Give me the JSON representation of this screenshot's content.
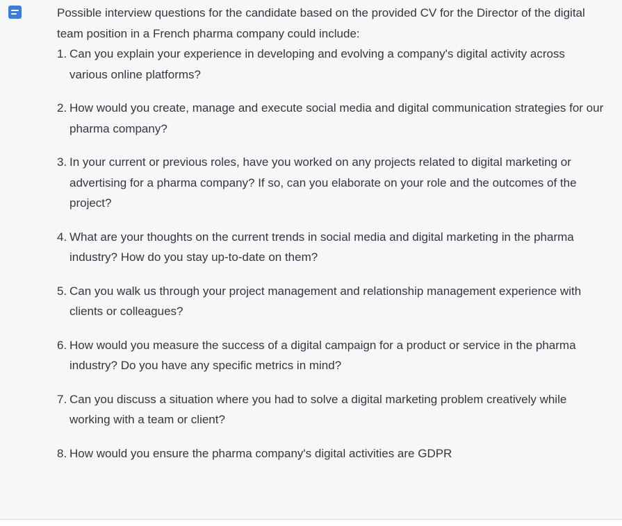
{
  "assistant": {
    "avatar_icon": "chat-bubble-icon",
    "accent_color": "#3d7be0"
  },
  "message": {
    "intro": "Possible interview questions for the candidate based on the provided CV for the Director of the digital team position in a French pharma company could include:",
    "questions": [
      {
        "num": "1.",
        "text": "Can you explain your experience in developing and evolving a company's digital activity across various online platforms?"
      },
      {
        "num": "2.",
        "text": "How would you create, manage and execute social media and digital communication strategies for our pharma company?"
      },
      {
        "num": "3.",
        "text": "In your current or previous roles, have you worked on any projects related to digital marketing or advertising for a pharma company? If so, can you elaborate on your role and the outcomes of the project?"
      },
      {
        "num": "4.",
        "text": "What are your thoughts on the current trends in social media and digital marketing in the pharma industry? How do you stay up-to-date on them?"
      },
      {
        "num": "5.",
        "text": "Can you walk us through your project management and relationship management experience with clients or colleagues?"
      },
      {
        "num": "6.",
        "text": "How would you measure the success of a digital campaign for a product or service in the pharma industry? Do you have any specific metrics in mind?"
      },
      {
        "num": "7.",
        "text": "Can you discuss a situation where you had to solve a digital marketing problem creatively while working with a team or client?"
      },
      {
        "num": "8.",
        "text": "How would you ensure the pharma company's digital activities are GDPR"
      }
    ]
  }
}
